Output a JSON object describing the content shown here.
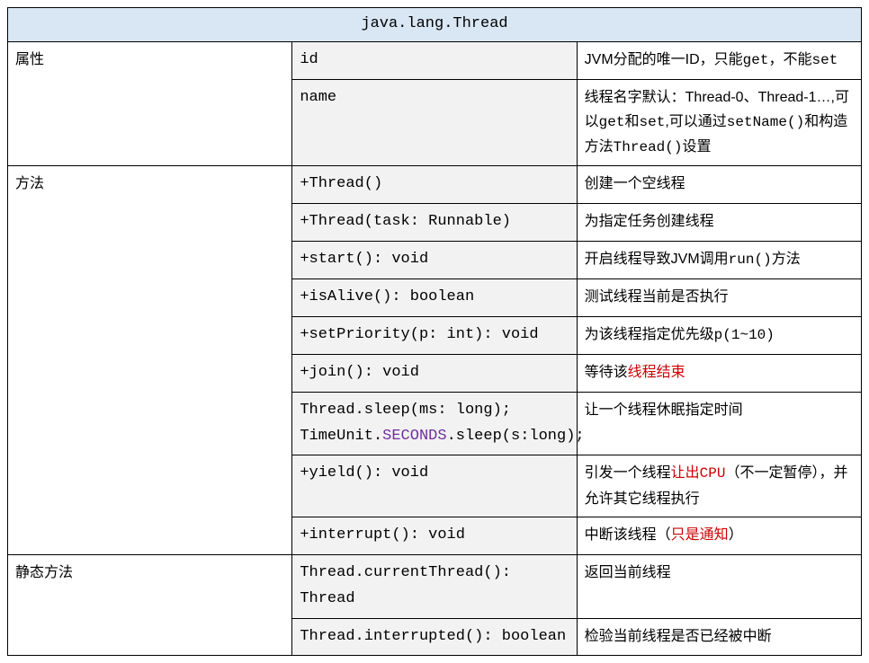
{
  "header_title": "java.lang.Thread",
  "cat_props": "属性",
  "cat_methods": "方法",
  "cat_static": "静态方法",
  "rows": {
    "prop_id_name": "id",
    "prop_id_desc_a": "JVM分配的唯一ID，只能",
    "prop_id_desc_get": "get",
    "prop_id_desc_b": "，不能",
    "prop_id_desc_set": "set",
    "prop_name_name": "name",
    "prop_name_desc_a": "线程名字默认：Thread-0、Thread-1…,可以",
    "prop_name_desc_get": "get",
    "prop_name_desc_and": "和",
    "prop_name_desc_set": "set",
    "prop_name_desc_b": ",可以通过",
    "prop_name_desc_setname": "setName()",
    "prop_name_desc_c": "和构造方法",
    "prop_name_desc_thread": "Thread()",
    "prop_name_desc_d": "设置",
    "m_thread": "+Thread()",
    "m_thread_desc": "创建一个空线程",
    "m_thread_runnable": "+Thread(task: Runnable)",
    "m_thread_runnable_desc": "为指定任务创建线程",
    "m_start": "+start(): void",
    "m_start_desc_a": "开启线程导致JVM调用",
    "m_start_desc_run": "run()",
    "m_start_desc_b": "方法",
    "m_isalive": "+isAlive(): boolean",
    "m_isalive_desc": "测试线程当前是否执行",
    "m_setpriority": "+setPriority(p: int): void",
    "m_setpriority_desc_a": "为该线程指定优先级",
    "m_setpriority_desc_p": "p(1~10)",
    "m_join": "+join(): void",
    "m_join_desc_a": "等待该",
    "m_join_desc_red": "线程结束",
    "m_sleep_1a": "Thread.sleep(ms: long);",
    "m_sleep_2a": "TimeUnit.",
    "m_sleep_2b": "SECONDS",
    "m_sleep_2c": ".sleep(s:long);",
    "m_sleep_desc": "让一个线程休眠指定时间",
    "m_yield": "+yield(): void",
    "m_yield_desc_a": "引发一个线程",
    "m_yield_desc_red": "让出CPU",
    "m_yield_desc_b": "（不一定暂停），并允许其它线程执行",
    "m_interrupt": "+interrupt(): void",
    "m_interrupt_desc_a": "中断该线程（",
    "m_interrupt_desc_red": "只是通知",
    "m_interrupt_desc_b": "）",
    "s_currentthread": "Thread.currentThread(): Thread",
    "s_currentthread_desc": "返回当前线程",
    "s_interrupted": "Thread.interrupted(): boolean",
    "s_interrupted_desc": "检验当前线程是否已经被中断"
  }
}
